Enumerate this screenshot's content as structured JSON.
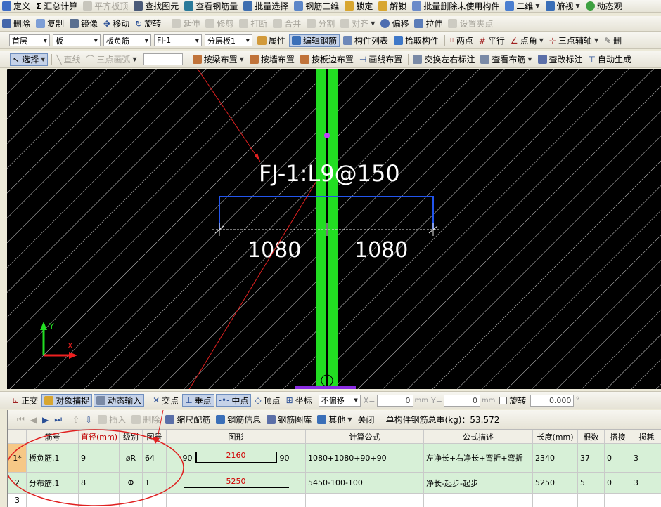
{
  "toolbar1": {
    "items": [
      "定义",
      "汇总计算",
      "平齐板顶",
      "查找图元",
      "查看钢筋量",
      "批量选择",
      "钢筋三维",
      "锁定",
      "解锁",
      "批量删除未使用构件",
      "二维",
      "俯视",
      "动态观"
    ]
  },
  "toolbar2": {
    "items": [
      "删除",
      "复制",
      "镜像",
      "移动",
      "旋转",
      "延伸",
      "修剪",
      "打断",
      "合并",
      "分割",
      "对齐",
      "偏移",
      "拉伸",
      "设置夹点"
    ]
  },
  "toolbar3": {
    "floor": "首层",
    "type": "板",
    "subtype": "板负筋",
    "component": "FJ-1",
    "layer": "分层板1",
    "items": [
      "属性",
      "编辑钢筋",
      "构件列表",
      "拾取构件",
      "两点",
      "平行",
      "点角",
      "三点辅轴",
      "删"
    ]
  },
  "toolbar4": {
    "items": [
      "选择",
      "直线",
      "三点画弧",
      "按梁布置",
      "按墙布置",
      "按板边布置",
      "画线布置",
      "交换左右标注",
      "查看布筋",
      "查改标注",
      "自动生成"
    ]
  },
  "canvas": {
    "label": "FJ-1:L9@150",
    "dim_left": "1080",
    "dim_right": "1080",
    "axis_x": "X",
    "axis_y": "Y"
  },
  "snapbar": {
    "items": [
      "正交",
      "对象捕捉",
      "动态输入",
      "交点",
      "垂点",
      "中点",
      "顶点",
      "坐标"
    ],
    "offset_mode": "不偏移",
    "x_label": "X=",
    "x_value": "0",
    "y_label": "Y=",
    "y_value": "0",
    "unit": "mm",
    "rotate_label": "旋转",
    "rotate_value": "0.000",
    "degree": "°"
  },
  "rebar_toolbar": {
    "items": [
      "插入",
      "删除",
      "缩尺配筋",
      "钢筋信息",
      "钢筋图库",
      "其他",
      "关闭"
    ],
    "total_label": "单构件钢筋总重(kg)：53.572"
  },
  "rebar_table": {
    "headers": [
      "筋号",
      "直径(mm)",
      "级别",
      "图号",
      "图形",
      "计算公式",
      "公式描述",
      "长度(mm)",
      "根数",
      "搭接",
      "损耗"
    ],
    "rows": [
      {
        "idx": "1*",
        "name": "板负筋.1",
        "diameter": "9",
        "grade": "⌀R",
        "fig": "64",
        "shape_left": "90",
        "shape_mid": "2160",
        "shape_right": "90",
        "formula": "1080+1080+90+90",
        "desc": "左净长+右净长+弯折+弯折",
        "length": "2340",
        "count": "37",
        "lap": "0",
        "loss": "3"
      },
      {
        "idx": "2",
        "name": "分布筋.1",
        "diameter": "8",
        "grade": "Φ",
        "fig": "1",
        "shape_left": "",
        "shape_mid": "5250",
        "shape_right": "",
        "formula": "5450-100-100",
        "desc": "净长-起步-起步",
        "length": "5250",
        "count": "5",
        "lap": "0",
        "loss": "3"
      },
      {
        "idx": "3",
        "name": "",
        "diameter": "",
        "grade": "",
        "fig": "",
        "shape_left": "",
        "shape_mid": "",
        "shape_right": "",
        "formula": "",
        "desc": "",
        "length": "",
        "count": "",
        "lap": "",
        "loss": ""
      }
    ]
  },
  "colors": {
    "canvas_bg": "#000000",
    "hatch": "#cfcfcf",
    "beam_green": "#22dd22",
    "annotation_blue": "#2255ee",
    "callout_red": "#e02020",
    "row_green": "#d7f0d7",
    "selected_cell": "#bfe0f8"
  }
}
